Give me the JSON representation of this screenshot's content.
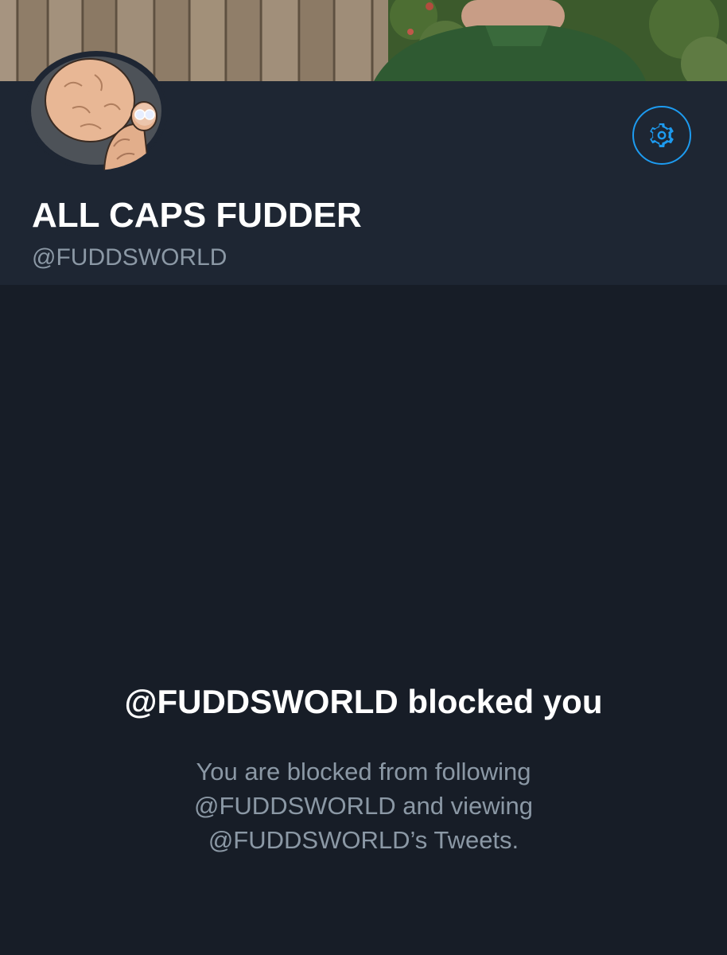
{
  "profile": {
    "display_name": "ALL CAPS FUDDER",
    "handle": "@FUDDSWORLD"
  },
  "header": {
    "settings_icon": "gear-icon"
  },
  "blocked": {
    "title": "@FUDDSWORLD blocked you",
    "description": "You are blocked from following @FUDDSWORLD and viewing @FUDDSWORLD’s Tweets."
  },
  "colors": {
    "background": "#171d27",
    "header_background": "#1e2633",
    "accent": "#1d9bf0",
    "primary_text": "#ffffff",
    "secondary_text": "#8b98a5"
  }
}
